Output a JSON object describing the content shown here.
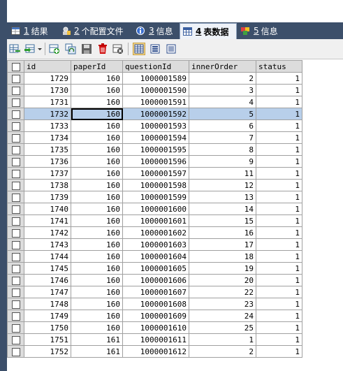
{
  "tabs": [
    {
      "num": "1",
      "label": "结果",
      "icon": "result-grid-icon",
      "active": false
    },
    {
      "num": "2",
      "label": "个配置文件",
      "icon": "profile-icon",
      "active": false
    },
    {
      "num": "3",
      "label": "信息",
      "icon": "info-icon",
      "active": false
    },
    {
      "num": "4",
      "label": "表数据",
      "icon": "table-data-icon",
      "active": true
    },
    {
      "num": "5",
      "label": "信息",
      "icon": "info-history-icon",
      "active": false
    }
  ],
  "toolbar_icons": [
    "export-icon",
    "import-icon",
    "dropdown-arrow-icon",
    "add-row-icon",
    "duplicate-row-icon",
    "save-icon",
    "delete-icon",
    "cancel-icon",
    "grid-view-icon",
    "form-view-icon",
    "text-view-icon"
  ],
  "columns": [
    "id",
    "paperId",
    "questionId",
    "innerOrder",
    "status"
  ],
  "rows": [
    [
      "1729",
      "160",
      "1000001589",
      "2",
      "1"
    ],
    [
      "1730",
      "160",
      "1000001590",
      "3",
      "1"
    ],
    [
      "1731",
      "160",
      "1000001591",
      "4",
      "1"
    ],
    [
      "1732",
      "160",
      "1000001592",
      "5",
      "1"
    ],
    [
      "1733",
      "160",
      "1000001593",
      "6",
      "1"
    ],
    [
      "1734",
      "160",
      "1000001594",
      "7",
      "1"
    ],
    [
      "1735",
      "160",
      "1000001595",
      "8",
      "1"
    ],
    [
      "1736",
      "160",
      "1000001596",
      "9",
      "1"
    ],
    [
      "1737",
      "160",
      "1000001597",
      "11",
      "1"
    ],
    [
      "1738",
      "160",
      "1000001598",
      "12",
      "1"
    ],
    [
      "1739",
      "160",
      "1000001599",
      "13",
      "1"
    ],
    [
      "1740",
      "160",
      "1000001600",
      "14",
      "1"
    ],
    [
      "1741",
      "160",
      "1000001601",
      "15",
      "1"
    ],
    [
      "1742",
      "160",
      "1000001602",
      "16",
      "1"
    ],
    [
      "1743",
      "160",
      "1000001603",
      "17",
      "1"
    ],
    [
      "1744",
      "160",
      "1000001604",
      "18",
      "1"
    ],
    [
      "1745",
      "160",
      "1000001605",
      "19",
      "1"
    ],
    [
      "1746",
      "160",
      "1000001606",
      "20",
      "1"
    ],
    [
      "1747",
      "160",
      "1000001607",
      "22",
      "1"
    ],
    [
      "1748",
      "160",
      "1000001608",
      "23",
      "1"
    ],
    [
      "1749",
      "160",
      "1000001609",
      "24",
      "1"
    ],
    [
      "1750",
      "160",
      "1000001610",
      "25",
      "1"
    ],
    [
      "1751",
      "161",
      "1000001611",
      "1",
      "1"
    ],
    [
      "1752",
      "161",
      "1000001612",
      "2",
      "1"
    ]
  ],
  "selected_row_index": 3,
  "selected_cell_column": 1
}
